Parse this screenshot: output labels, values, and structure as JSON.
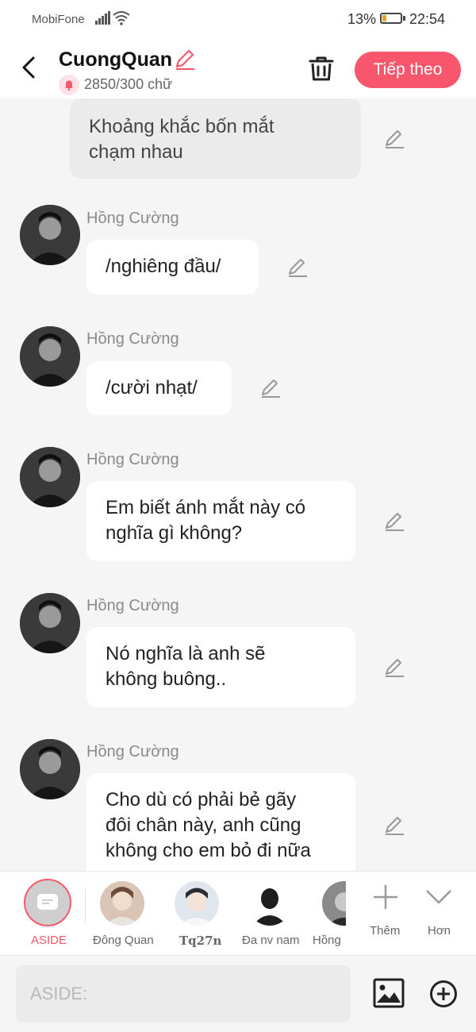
{
  "status_bar": {
    "carrier": "MobiFone",
    "battery": "13%",
    "time": "22:54"
  },
  "header": {
    "title": "CuongQuan",
    "word_count": "2850/300 chữ",
    "next_label": "Tiếp theo"
  },
  "messages": [
    {
      "type": "narration",
      "lines": [
        "Khoảng khắc bốn mắt",
        "chạm nhau"
      ]
    },
    {
      "type": "character",
      "sender": "Hồng Cường",
      "lines": [
        "/nghiêng đầu/"
      ]
    },
    {
      "type": "character",
      "sender": "Hồng Cường",
      "lines": [
        "/cười nhạt/"
      ]
    },
    {
      "type": "character",
      "sender": "Hồng Cường",
      "lines": [
        "Em biết ánh mắt này có",
        "nghĩa gì không?"
      ]
    },
    {
      "type": "character",
      "sender": "Hồng Cường",
      "lines": [
        "Nó nghĩa là anh sẽ",
        "không buông.."
      ]
    },
    {
      "type": "character",
      "sender": "Hồng Cường",
      "lines": [
        "Cho dù có phải bẻ gãy",
        "đôi chân này, anh cũng",
        "không cho em bỏ đi nữa"
      ]
    }
  ],
  "character_bar": {
    "items": [
      {
        "label": "ASIDE",
        "icon": "aside-icon",
        "selected": true
      },
      {
        "label": "Đông Quan",
        "icon": "avatar"
      },
      {
        "label": "Tq27n",
        "icon": "avatar"
      },
      {
        "label": "Đa nv nam",
        "icon": "silhouette-avatar"
      },
      {
        "label": "Hồng",
        "icon": "avatar"
      }
    ],
    "add_label": "Thêm",
    "more_label": "Hơn"
  },
  "input": {
    "placeholder": "ASIDE:"
  },
  "colors": {
    "accent": "#f8566c",
    "background": "#f5f5f5",
    "bubble": "#ffffff",
    "narration_bubble": "#ebebeb"
  }
}
